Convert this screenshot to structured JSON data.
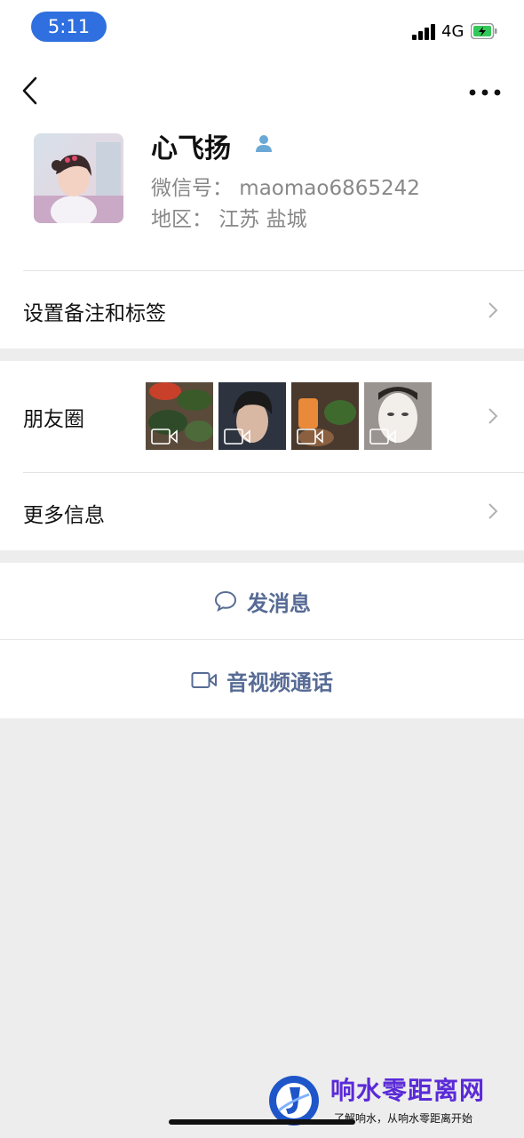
{
  "status_bar": {
    "time": "5:11",
    "network": "4G"
  },
  "nav": {
    "back_icon": "chevron-left-icon",
    "more_icon": "ellipsis-icon"
  },
  "profile": {
    "name": "心飞扬",
    "wechat_id": "微信号： maomao6865242",
    "region": "地区： 江苏 盐城",
    "badge_color": "#6aa8d6"
  },
  "rows": {
    "remark": "设置备注和标签",
    "moments": "朋友圈",
    "more_info": "更多信息"
  },
  "moments_thumbs": [
    "video-thumbnail-food",
    "video-thumbnail-man",
    "video-thumbnail-drinks",
    "video-thumbnail-face-mask"
  ],
  "actions": {
    "message": "发消息",
    "call": "音视频通话",
    "accent": "#576b95"
  },
  "watermark": {
    "title": "响水零距离网",
    "subtitle": "了解响水，从响水零距离开始"
  }
}
